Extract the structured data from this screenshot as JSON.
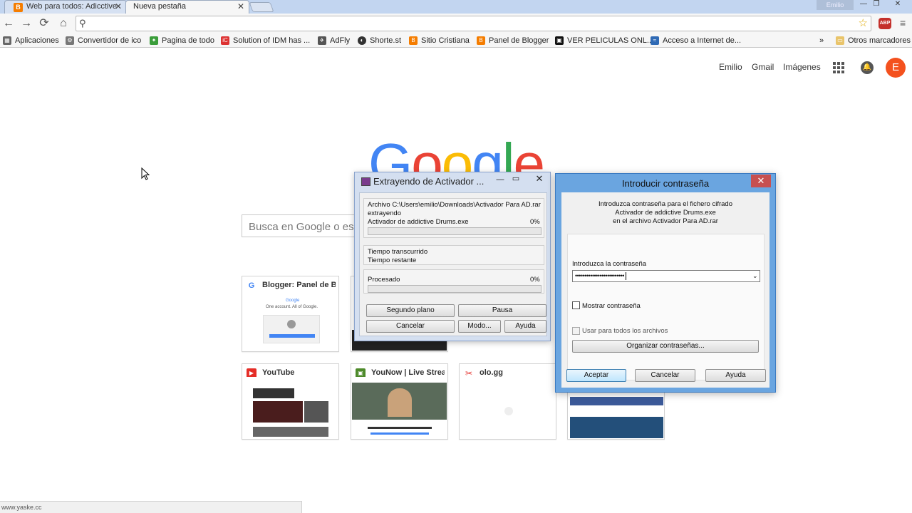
{
  "browser": {
    "tabs": [
      {
        "title": "Web para todos: Adicctive",
        "favicon": "blogger-icon",
        "active": false
      },
      {
        "title": "Nueva pestaña",
        "active": true
      }
    ],
    "window_user": "Emilio",
    "address_value": "",
    "bookmarks": [
      {
        "label": "Aplicaciones",
        "icon": "apps-grid-icon"
      },
      {
        "label": "Convertidor de ico",
        "icon": "gear-icon"
      },
      {
        "label": "Pagina de todo",
        "icon": "figure-icon"
      },
      {
        "label": "Solution of IDM has ...",
        "icon": "idm-icon"
      },
      {
        "label": "AdFly",
        "icon": "adfly-icon"
      },
      {
        "label": "Shorte.st",
        "icon": "shortest-icon"
      },
      {
        "label": "Sitio Cristiana",
        "icon": "blogger-icon"
      },
      {
        "label": "Panel de Blogger",
        "icon": "blogger-icon"
      },
      {
        "label": "VER PELICULAS ONL...",
        "icon": "film-icon"
      },
      {
        "label": "Acceso a Internet de...",
        "icon": "network-icon"
      }
    ],
    "other_bookmarks": "Otros marcadores",
    "status_url": "www.yaske.cc"
  },
  "google": {
    "links": [
      "Emilio",
      "Gmail",
      "Imágenes"
    ],
    "avatar_letter": "E",
    "search_placeholder": "Busca en Google o esc",
    "tiles": [
      {
        "title": "Blogger: Panel de Blo",
        "icon": "google-icon"
      },
      {
        "title": "YouTube",
        "icon": "youtube-icon"
      },
      {
        "title": "YouNow | Live Stream",
        "icon": "younow-icon"
      },
      {
        "title": "olo.gg",
        "icon": "scissors-icon"
      }
    ],
    "thumb_blogger_text": "One account. All of Google."
  },
  "extract_dialog": {
    "title": "Extrayendo de Activador ...",
    "archive_line": "Archivo C:\\Users\\emilio\\Downloads\\Activador Para AD.rar",
    "status": "extrayendo",
    "current_file": "Activador de addictive Drums.exe",
    "file_percent": "0%",
    "file_progress": 0,
    "elapsed_label": "Tiempo transcurrido",
    "remaining_label": "Tiempo restante",
    "processed_label": "Procesado",
    "processed_percent": "0%",
    "processed_progress": 0,
    "buttons": {
      "background": "Segundo plano",
      "pause": "Pausa",
      "cancel": "Cancelar",
      "mode": "Modo...",
      "help": "Ayuda"
    }
  },
  "password_dialog": {
    "title": "Introducir contraseña",
    "message_lines": [
      "Introduzca contraseña para el fichero cifrado",
      "Activador de addictive Drums.exe",
      "en el archivo Activador Para AD.rar"
    ],
    "field_label": "Introduzca la contraseña",
    "masked_value": "••••••••••••••••••••••••••",
    "show_password": "Mostrar contraseña",
    "use_for_all": "Usar para todos los archivos",
    "organize": "Organizar contraseñas...",
    "ok": "Aceptar",
    "cancel": "Cancelar",
    "help": "Ayuda"
  },
  "colors": {
    "google_blue": "#4285f4",
    "google_red": "#ea4335",
    "google_yellow": "#fbbc05",
    "google_green": "#34a853",
    "avatar": "#f4511e",
    "dialog_frame": "#6aa5e0"
  }
}
